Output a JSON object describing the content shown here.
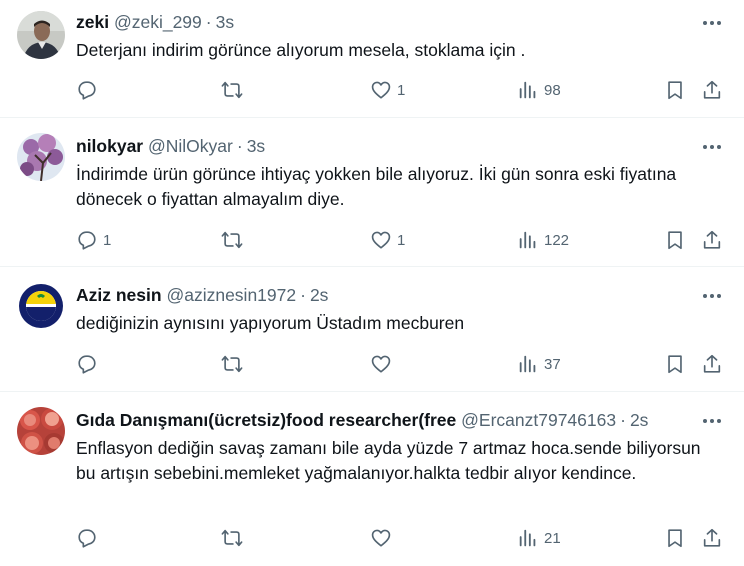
{
  "tweets": [
    {
      "name": "zeki",
      "handle": "@zeki_299",
      "time": "3s",
      "text": "Deterjanı  indirim görünce alıyorum  mesela,  stoklama için .",
      "replies": "",
      "reposts": "",
      "likes": "1",
      "views": "98"
    },
    {
      "name": "nilokyar",
      "handle": "@NilOkyar",
      "time": "3s",
      "text": "İndirimde ürün görünce ihtiyaç yokken bile alıyoruz. İki gün sonra eski fiyatına dönecek o fiyattan almayalım diye.",
      "replies": "1",
      "reposts": "",
      "likes": "1",
      "views": "122"
    },
    {
      "name": "Aziz nesin",
      "handle": "@aziznesin1972",
      "time": "2s",
      "text": "dediğinizin aynısını yapıyorum Üstadım mecburen",
      "replies": "",
      "reposts": "",
      "likes": "",
      "views": "37"
    },
    {
      "name": "Gıda Danışmanı(ücretsiz)food researcher(free",
      "handle": "@Ercanzt79746163",
      "time": "2s",
      "text": "Enflasyon dediğin savaş zamanı bile ayda yüzde 7 artmaz hoca.sende biliyorsun bu artışın sebebini.memleket yağmalanıyor.halkta tedbir alıyor kendince.",
      "replies": "",
      "reposts": "",
      "likes": "",
      "views": "21"
    }
  ],
  "separator": "·",
  "colors": {
    "text": "#0f1419",
    "secondary": "#536471",
    "border": "#eff3f4"
  },
  "icons": [
    "reply-icon",
    "repost-icon",
    "like-icon",
    "views-icon",
    "bookmark-icon",
    "share-icon",
    "more-icon"
  ]
}
